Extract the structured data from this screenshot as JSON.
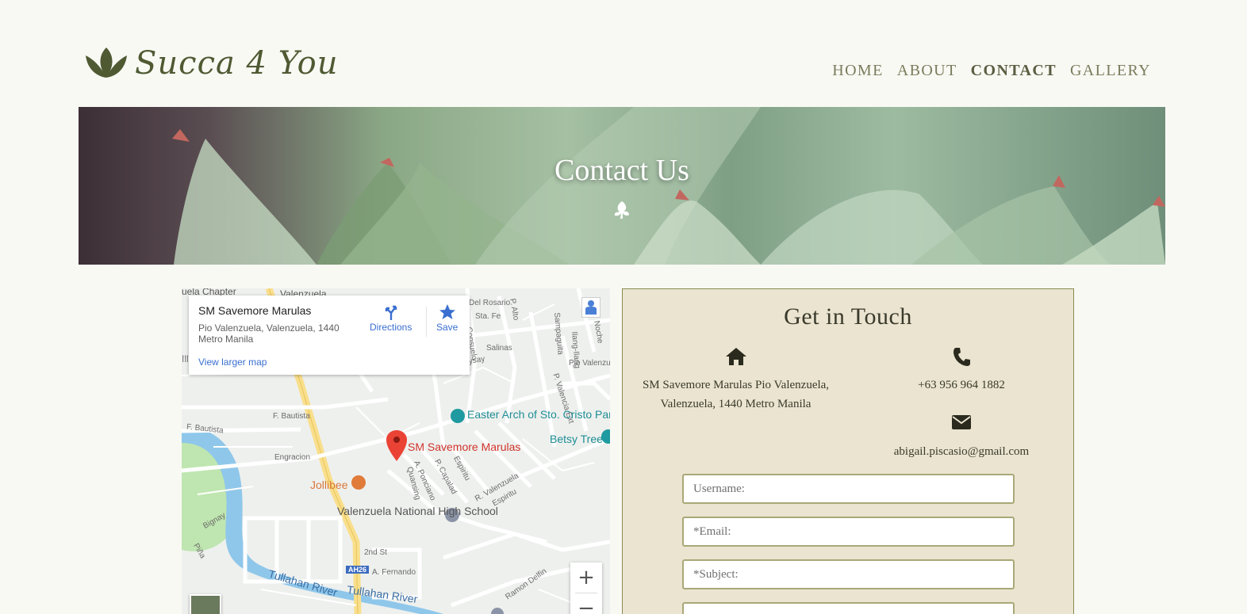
{
  "brand": {
    "name": "Succa 4 You"
  },
  "nav": {
    "items": [
      {
        "label": "HOME",
        "active": false
      },
      {
        "label": "ABOUT",
        "active": false
      },
      {
        "label": "CONTACT",
        "active": true
      },
      {
        "label": "GALLERY",
        "active": false
      }
    ]
  },
  "hero": {
    "title": "Contact Us",
    "icon": "leaf-icon"
  },
  "map": {
    "card": {
      "place_name": "SM Savemore Marulas",
      "address": "Pio Valenzuela, Valenzuela, 1440 Metro Manila",
      "directions_label": "Directions",
      "save_label": "Save",
      "larger_map_link": "View larger map"
    },
    "labels": {
      "chapter": "uela Chapter",
      "valenzuela_top": "Valenzuela",
      "del_rosario": "Del Rosario",
      "sta_fe": "Sta. Fe",
      "consuelo": "Consuelo",
      "salinas": "Salinas",
      "sampaguita": "Sampaguita",
      "ilang_ilang": "Ilang-Ilang",
      "noche": "Noche",
      "pio_valenzu": "Pio Valenzu",
      "p_alto": "P. Alto",
      "m_gsaysay": "M. gsaysay",
      "p_valencia_ext": "P. Valencia Ext",
      "f_bautista_1": "F. Bautista",
      "f_bautista_2": "F. Bautista",
      "engracion": "Engracion",
      "easter_arch": "Easter Arch of Sto. Cristo Parish",
      "betsy_tree": "Betsy Tree",
      "marker_label": "SM Savemore Marulas",
      "jollibee": "Jollibee",
      "a_ponciano": "A. Ponciano",
      "p_capalad": "P. Capalad",
      "espiritu": "Espiritu",
      "quansing": "Quansing",
      "r_valenzuela": "R. Valenzuela",
      "espiritu_2": "Espiritu",
      "school": "Valenzuela National High School",
      "bignay": "Bignay",
      "pina": "Piña",
      "second_st": "2nd St",
      "ah26": "AH26",
      "a_fernando": "A. Fernando",
      "ramon_delfin": "Ramon Delfin",
      "river_1": "Tullahan River",
      "river_2": "Tullahan River",
      "ille": "Ille"
    },
    "zoom_in": "+",
    "zoom_out": "−"
  },
  "contact": {
    "title": "Get in Touch",
    "address": "SM Savemore Marulas Pio Valenzuela, Valenzuela, 1440 Metro Manila",
    "phone": "+63 956 964 1882",
    "email": "abigail.piscasio@gmail.com",
    "fields": {
      "username_placeholder": "Username:",
      "email_placeholder": "*Email:",
      "subject_placeholder": "*Subject:"
    }
  },
  "colors": {
    "background": "#f9f9f4",
    "brand_green": "#4f5a33",
    "panel_bg": "#eae4d0",
    "panel_border": "#8a8c52",
    "input_border": "#a9a878",
    "map_link": "#3a6fd0",
    "marker_red": "#d0342c"
  }
}
